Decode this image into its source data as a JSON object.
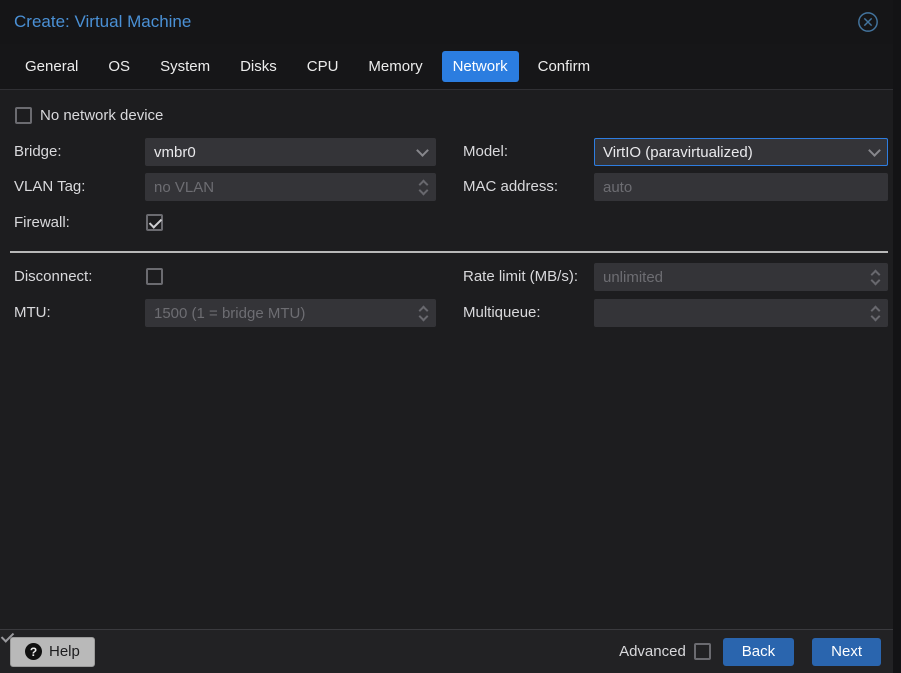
{
  "window": {
    "title": "Create: Virtual Machine"
  },
  "tabs": [
    {
      "label": "General",
      "active": false
    },
    {
      "label": "OS",
      "active": false
    },
    {
      "label": "System",
      "active": false
    },
    {
      "label": "Disks",
      "active": false
    },
    {
      "label": "CPU",
      "active": false
    },
    {
      "label": "Memory",
      "active": false
    },
    {
      "label": "Network",
      "active": true
    },
    {
      "label": "Confirm",
      "active": false
    }
  ],
  "form": {
    "no_network_device": {
      "label": "No network device",
      "checked": false
    },
    "bridge": {
      "label": "Bridge:",
      "value": "vmbr0",
      "type": "combobox"
    },
    "model": {
      "label": "Model:",
      "value": "VirtIO (paravirtualized)",
      "type": "combobox",
      "focused": true
    },
    "vlan_tag": {
      "label": "VLAN Tag:",
      "value": "",
      "placeholder": "no VLAN",
      "type": "spinner"
    },
    "mac_address": {
      "label": "MAC address:",
      "value": "",
      "placeholder": "auto",
      "type": "text"
    },
    "firewall": {
      "label": "Firewall:",
      "checked": true
    },
    "disconnect": {
      "label": "Disconnect:",
      "checked": false
    },
    "rate_limit": {
      "label": "Rate limit (MB/s):",
      "value": "",
      "placeholder": "unlimited",
      "type": "spinner"
    },
    "mtu": {
      "label": "MTU:",
      "value": "",
      "placeholder": "1500 (1 = bridge MTU)",
      "type": "spinner"
    },
    "multiqueue": {
      "label": "Multiqueue:",
      "value": "",
      "placeholder": "",
      "type": "spinner"
    }
  },
  "footer": {
    "help_label": "Help",
    "help_icon_glyph": "?",
    "advanced_label": "Advanced",
    "advanced_checked": true,
    "back_label": "Back",
    "next_label": "Next"
  },
  "colors": {
    "title_blue": "#4a90d5",
    "active_tab_blue": "#2b7de0",
    "button_blue": "#2a65ae",
    "focus_border_blue": "#2e7de0",
    "dialog_bg": "#1d1d1f",
    "field_bg": "#343438",
    "divider": "#b8b8b8"
  }
}
